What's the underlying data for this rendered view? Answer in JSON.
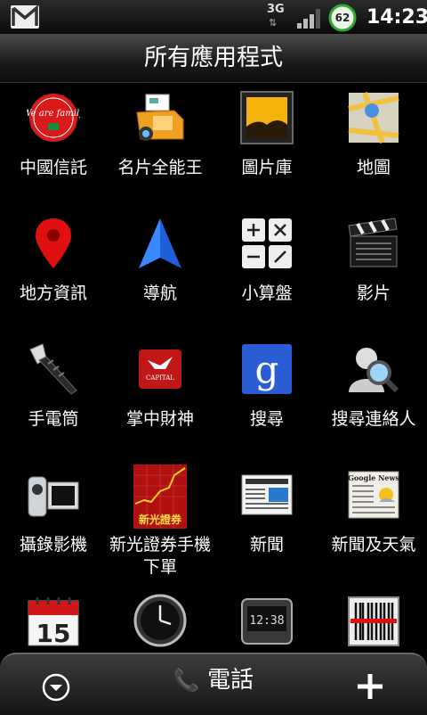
{
  "status": {
    "network": "3G",
    "battery": "62",
    "time": "14:23"
  },
  "header": {
    "title": "所有應用程式"
  },
  "apps": [
    {
      "label": "中國信託"
    },
    {
      "label": "名片全能王"
    },
    {
      "label": "圖片庫"
    },
    {
      "label": "地圖"
    },
    {
      "label": "地方資訊"
    },
    {
      "label": "導航"
    },
    {
      "label": "小算盤"
    },
    {
      "label": "影片"
    },
    {
      "label": "手電筒"
    },
    {
      "label": "掌中財神"
    },
    {
      "label": "搜尋"
    },
    {
      "label": "搜尋連絡人"
    },
    {
      "label": "攝錄影機"
    },
    {
      "label": "新光證券手機下單"
    },
    {
      "label": "新聞"
    },
    {
      "label": "新聞及天氣"
    },
    {
      "label": ""
    },
    {
      "label": ""
    },
    {
      "label": ""
    },
    {
      "label": ""
    }
  ],
  "icon_text": {
    "calendar_day": "15",
    "clock_display": "12:38",
    "capital": "CAPITAL",
    "securities": "新光證券",
    "google_news": "Google News",
    "google_g": "g",
    "wearefamily": "We are family"
  },
  "bottom": {
    "phone_label": "電話"
  }
}
